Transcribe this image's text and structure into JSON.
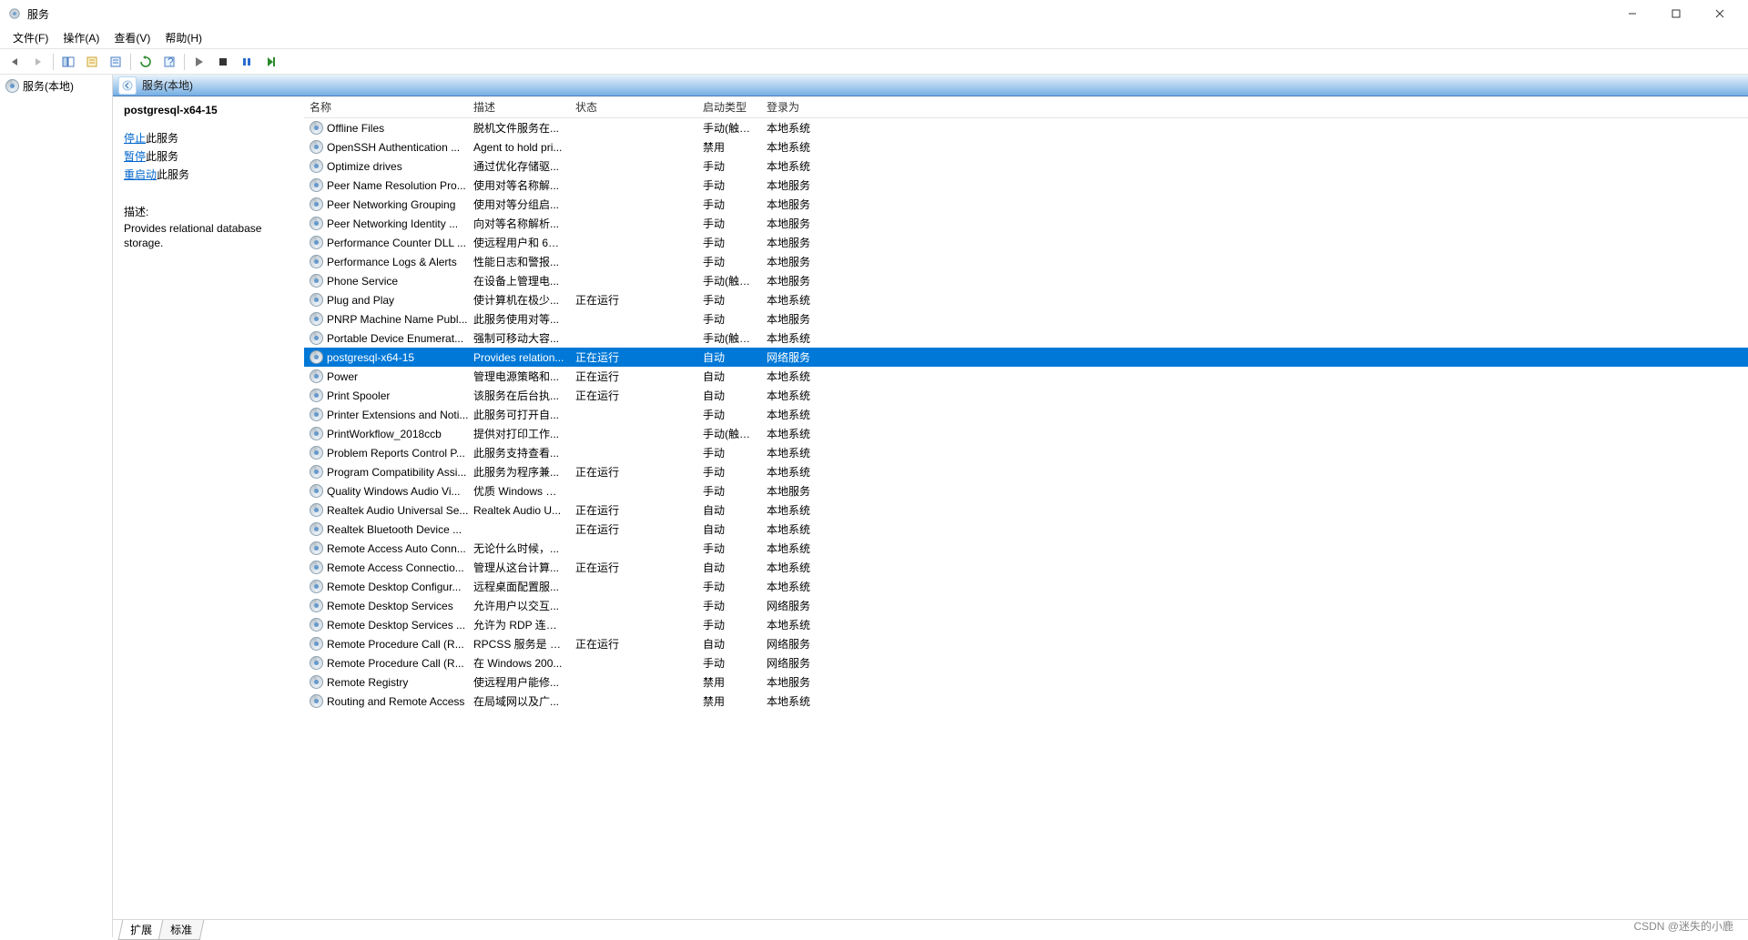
{
  "window": {
    "title": "服务"
  },
  "menus": {
    "file": "文件(F)",
    "action": "操作(A)",
    "view": "查看(V)",
    "help": "帮助(H)"
  },
  "nav": {
    "local": "服务(本地)"
  },
  "content_header": "服务(本地)",
  "detail": {
    "service_name": "postgresql-x64-15",
    "stop_link": "停止",
    "stop_suffix": "此服务",
    "pause_link": "暂停",
    "pause_suffix": "此服务",
    "restart_link": "重启动",
    "restart_suffix": "此服务",
    "desc_heading": "描述:",
    "desc_text": "Provides relational database storage."
  },
  "columns": {
    "name": "名称",
    "desc": "描述",
    "status": "状态",
    "start": "启动类型",
    "logon": "登录为"
  },
  "services": [
    {
      "name": "Offline Files",
      "desc": "脱机文件服务在...",
      "status": "",
      "start": "手动(触发...",
      "logon": "本地系统"
    },
    {
      "name": "OpenSSH Authentication ...",
      "desc": "Agent to hold pri...",
      "status": "",
      "start": "禁用",
      "logon": "本地系统"
    },
    {
      "name": "Optimize drives",
      "desc": "通过优化存储驱...",
      "status": "",
      "start": "手动",
      "logon": "本地系统"
    },
    {
      "name": "Peer Name Resolution Pro...",
      "desc": "使用对等名称解...",
      "status": "",
      "start": "手动",
      "logon": "本地服务"
    },
    {
      "name": "Peer Networking Grouping",
      "desc": "使用对等分组启...",
      "status": "",
      "start": "手动",
      "logon": "本地服务"
    },
    {
      "name": "Peer Networking Identity ...",
      "desc": "向对等名称解析...",
      "status": "",
      "start": "手动",
      "logon": "本地服务"
    },
    {
      "name": "Performance Counter DLL ...",
      "desc": "使远程用户和 64 ...",
      "status": "",
      "start": "手动",
      "logon": "本地服务"
    },
    {
      "name": "Performance Logs & Alerts",
      "desc": "性能日志和警报...",
      "status": "",
      "start": "手动",
      "logon": "本地服务"
    },
    {
      "name": "Phone Service",
      "desc": "在设备上管理电...",
      "status": "",
      "start": "手动(触发...",
      "logon": "本地服务"
    },
    {
      "name": "Plug and Play",
      "desc": "使计算机在极少...",
      "status": "正在运行",
      "start": "手动",
      "logon": "本地系统"
    },
    {
      "name": "PNRP Machine Name Publ...",
      "desc": "此服务使用对等...",
      "status": "",
      "start": "手动",
      "logon": "本地服务"
    },
    {
      "name": "Portable Device Enumerat...",
      "desc": "强制可移动大容...",
      "status": "",
      "start": "手动(触发...",
      "logon": "本地系统"
    },
    {
      "name": "postgresql-x64-15",
      "desc": "Provides relation...",
      "status": "正在运行",
      "start": "自动",
      "logon": "网络服务",
      "selected": true
    },
    {
      "name": "Power",
      "desc": "管理电源策略和...",
      "status": "正在运行",
      "start": "自动",
      "logon": "本地系统"
    },
    {
      "name": "Print Spooler",
      "desc": "该服务在后台执...",
      "status": "正在运行",
      "start": "自动",
      "logon": "本地系统"
    },
    {
      "name": "Printer Extensions and Noti...",
      "desc": "此服务可打开自...",
      "status": "",
      "start": "手动",
      "logon": "本地系统"
    },
    {
      "name": "PrintWorkflow_2018ccb",
      "desc": "提供对打印工作...",
      "status": "",
      "start": "手动(触发...",
      "logon": "本地系统"
    },
    {
      "name": "Problem Reports Control P...",
      "desc": "此服务支持查看...",
      "status": "",
      "start": "手动",
      "logon": "本地系统"
    },
    {
      "name": "Program Compatibility Assi...",
      "desc": "此服务为程序兼...",
      "status": "正在运行",
      "start": "手动",
      "logon": "本地系统"
    },
    {
      "name": "Quality Windows Audio Vi...",
      "desc": "优质 Windows 音...",
      "status": "",
      "start": "手动",
      "logon": "本地服务"
    },
    {
      "name": "Realtek Audio Universal Se...",
      "desc": "Realtek Audio U...",
      "status": "正在运行",
      "start": "自动",
      "logon": "本地系统"
    },
    {
      "name": "Realtek Bluetooth Device ...",
      "desc": "",
      "status": "正在运行",
      "start": "自动",
      "logon": "本地系统"
    },
    {
      "name": "Remote Access Auto Conn...",
      "desc": "无论什么时候，...",
      "status": "",
      "start": "手动",
      "logon": "本地系统"
    },
    {
      "name": "Remote Access Connectio...",
      "desc": "管理从这台计算...",
      "status": "正在运行",
      "start": "自动",
      "logon": "本地系统"
    },
    {
      "name": "Remote Desktop Configur...",
      "desc": "远程桌面配置服...",
      "status": "",
      "start": "手动",
      "logon": "本地系统"
    },
    {
      "name": "Remote Desktop Services",
      "desc": "允许用户以交互...",
      "status": "",
      "start": "手动",
      "logon": "网络服务"
    },
    {
      "name": "Remote Desktop Services ...",
      "desc": "允许为 RDP 连接...",
      "status": "",
      "start": "手动",
      "logon": "本地系统"
    },
    {
      "name": "Remote Procedure Call (R...",
      "desc": "RPCSS 服务是 C...",
      "status": "正在运行",
      "start": "自动",
      "logon": "网络服务"
    },
    {
      "name": "Remote Procedure Call (R...",
      "desc": "在 Windows 200...",
      "status": "",
      "start": "手动",
      "logon": "网络服务"
    },
    {
      "name": "Remote Registry",
      "desc": "使远程用户能修...",
      "status": "",
      "start": "禁用",
      "logon": "本地服务"
    },
    {
      "name": "Routing and Remote Access",
      "desc": "在局域网以及广...",
      "status": "",
      "start": "禁用",
      "logon": "本地系统"
    }
  ],
  "tabs": {
    "ext": "扩展",
    "std": "标准"
  },
  "watermark": "CSDN @迷失的小鹿"
}
